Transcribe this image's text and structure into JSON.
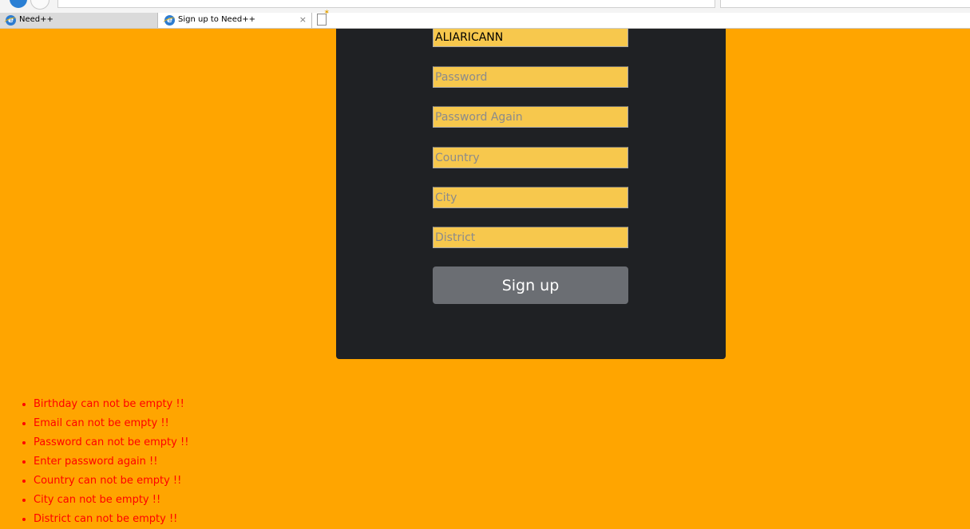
{
  "browser": {
    "tabs": [
      {
        "label": "Need++",
        "active": false,
        "icon": "ie-icon"
      },
      {
        "label": "Sign up to Need++",
        "active": true,
        "icon": "ie-icon",
        "close": "×"
      }
    ]
  },
  "form": {
    "username_value": "ALIARICANN",
    "fields": [
      {
        "placeholder": "Password"
      },
      {
        "placeholder": "Password Again"
      },
      {
        "placeholder": "Country"
      },
      {
        "placeholder": "City"
      },
      {
        "placeholder": "District"
      }
    ],
    "submit_label": "Sign up"
  },
  "errors": [
    "Birthday can not be empty !!",
    "Email can not be empty !!",
    "Password can not be empty !!",
    "Enter password again !!",
    "Country can not be empty !!",
    "City can not be empty !!",
    "District can not be empty !!"
  ],
  "colors": {
    "page_background": "#ffa500",
    "card_background": "#1f2124",
    "input_background": "#f7c84d",
    "button_background": "#6b6e73",
    "error_text": "#ff0000"
  }
}
